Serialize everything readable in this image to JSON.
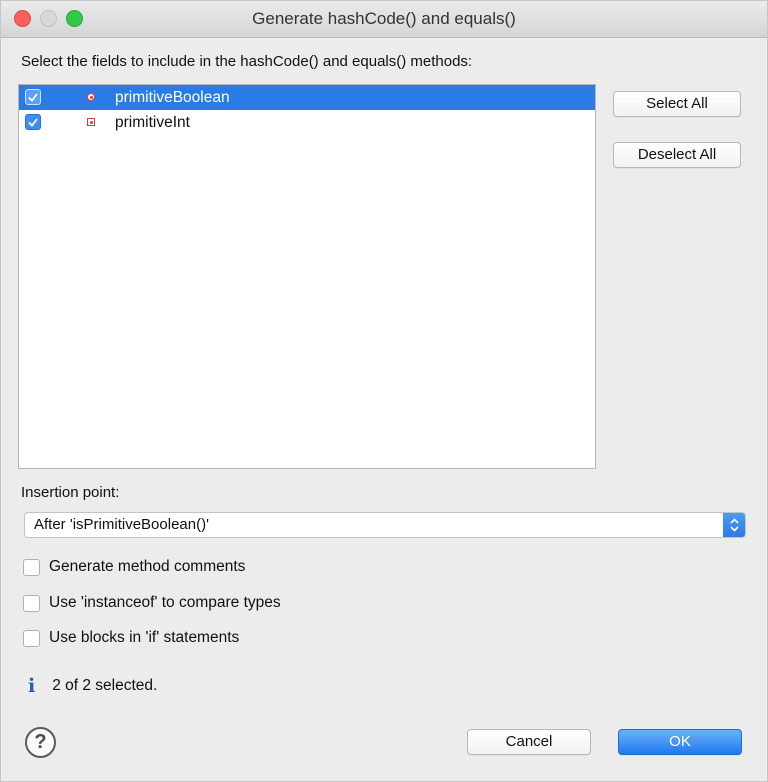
{
  "window": {
    "title": "Generate hashCode() and equals()"
  },
  "prompt": "Select the fields to include in the hashCode() and equals() methods:",
  "fields": [
    {
      "label": "primitiveBoolean",
      "checked": true,
      "selected": true,
      "icon": "field-private-icon"
    },
    {
      "label": "primitiveInt",
      "checked": true,
      "selected": false,
      "icon": "field-private-icon"
    }
  ],
  "buttons": {
    "select_all": "Select All",
    "deselect_all": "Deselect All",
    "cancel": "Cancel",
    "ok": "OK"
  },
  "insertion": {
    "label": "Insertion point:",
    "value": "After 'isPrimitiveBoolean()'"
  },
  "options": [
    {
      "label": "Generate method comments",
      "checked": false
    },
    {
      "label": "Use 'instanceof' to compare types",
      "checked": false
    },
    {
      "label": "Use blocks in 'if' statements",
      "checked": false
    }
  ],
  "status": {
    "text": "2 of 2 selected."
  },
  "colors": {
    "accent": "#2a7be4",
    "close": "#fc605c",
    "maximize": "#34c84a"
  }
}
